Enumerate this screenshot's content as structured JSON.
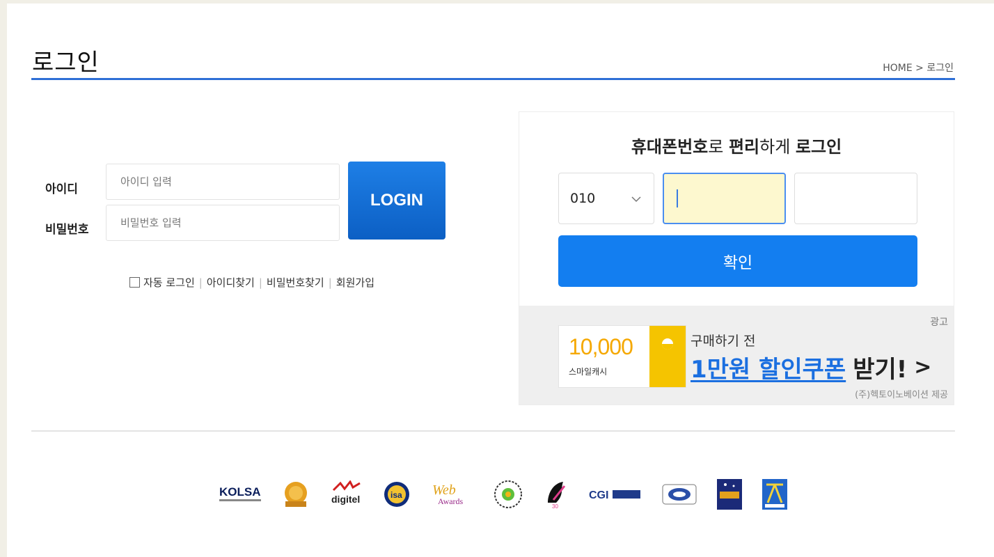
{
  "header": {
    "title": "로그인",
    "breadcrumb": "HOME > 로그인"
  },
  "login": {
    "id_label": "아이디",
    "id_placeholder": "아이디 입력",
    "pw_label": "비밀번호",
    "pw_placeholder": "비밀번호 입력",
    "login_button": "LOGIN",
    "links": {
      "auto_login": "자동 로그인",
      "find_id": "아이디찾기",
      "find_pw": "비밀번호찾기",
      "signup": "회원가입"
    }
  },
  "phone_login": {
    "title_parts": [
      "휴대폰번호",
      "로 ",
      "편리",
      "하게 ",
      "로그인"
    ],
    "prefix_value": "010",
    "confirm_button": "확인"
  },
  "ad": {
    "label": "광고",
    "amount": "10,000",
    "cash_label": "스마일캐시",
    "before": "구매하기 전",
    "coupon": "1만원 할인쿠폰",
    "receive": "받기!",
    "arrow": ">",
    "provider": "(주)헥토이노베이션 제공"
  },
  "footer": {
    "logos": [
      {
        "name": "kolsa-logo",
        "text": "KOLSA"
      },
      {
        "name": "award-badge-logo",
        "text": ""
      },
      {
        "name": "digitel-logo",
        "text": "digitel"
      },
      {
        "name": "isa-logo",
        "text": "isa"
      },
      {
        "name": "web-awards-logo",
        "text": "Awards"
      },
      {
        "name": "seal-logo",
        "text": ""
      },
      {
        "name": "hand-logo",
        "text": ""
      },
      {
        "name": "cgi-logo",
        "text": "CGI"
      },
      {
        "name": "eye-logo",
        "text": ""
      },
      {
        "name": "night-logo",
        "text": ""
      },
      {
        "name": "figure-logo",
        "text": ""
      }
    ]
  },
  "colors": {
    "accent": "#2e6fd6",
    "confirm": "#137ef0",
    "ad_amount": "#f5a800",
    "coupon": "#1b6fe0"
  }
}
